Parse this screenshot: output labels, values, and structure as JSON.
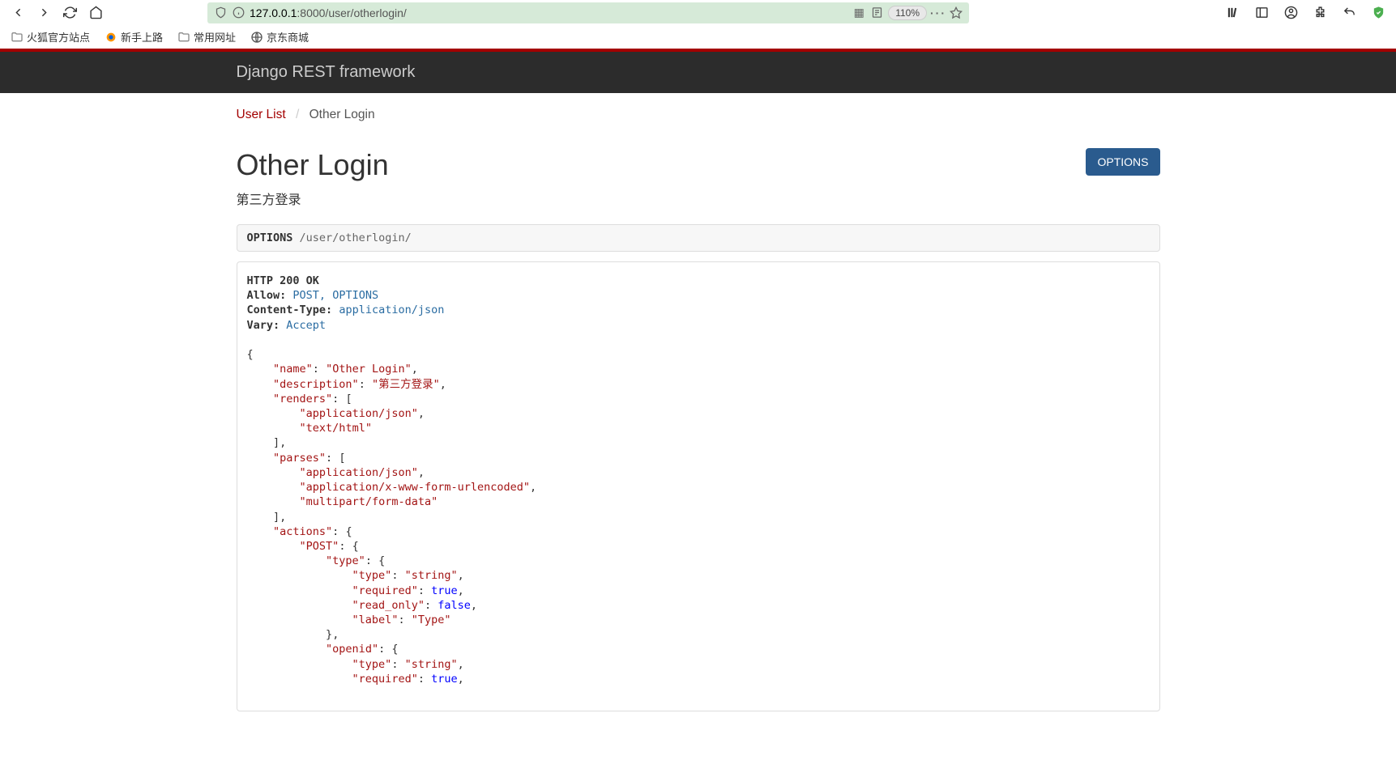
{
  "browser": {
    "url_host": "127.0.0.1",
    "url_port_path": ":8000/user/otherlogin/",
    "zoom": "110%",
    "bookmarks": [
      {
        "label": "火狐官方站点",
        "icon": "folder"
      },
      {
        "label": "新手上路",
        "icon": "firefox"
      },
      {
        "label": "常用网址",
        "icon": "folder"
      },
      {
        "label": "京东商城",
        "icon": "globe"
      }
    ]
  },
  "drf": {
    "brand": "Django REST framework",
    "breadcrumb_root": "User List",
    "breadcrumb_current": "Other Login",
    "page_title": "Other Login",
    "page_desc": "第三方登录",
    "options_btn": "OPTIONS",
    "request_method": "OPTIONS",
    "request_path": " /user/otherlogin/",
    "status_line": "HTTP 200 OK",
    "headers": [
      {
        "name": "Allow:",
        "value": "POST, OPTIONS"
      },
      {
        "name": "Content-Type:",
        "value": "application/json"
      },
      {
        "name": "Vary:",
        "value": "Accept"
      }
    ],
    "json_body": {
      "name": "Other Login",
      "description": "第三方登录",
      "renders": [
        "application/json",
        "text/html"
      ],
      "parses": [
        "application/json",
        "application/x-www-form-urlencoded",
        "multipart/form-data"
      ],
      "actions": {
        "POST": {
          "type": {
            "type": "string",
            "required": true,
            "read_only": false,
            "label": "Type"
          },
          "openid": {
            "type": "string",
            "required": true
          }
        }
      }
    }
  }
}
